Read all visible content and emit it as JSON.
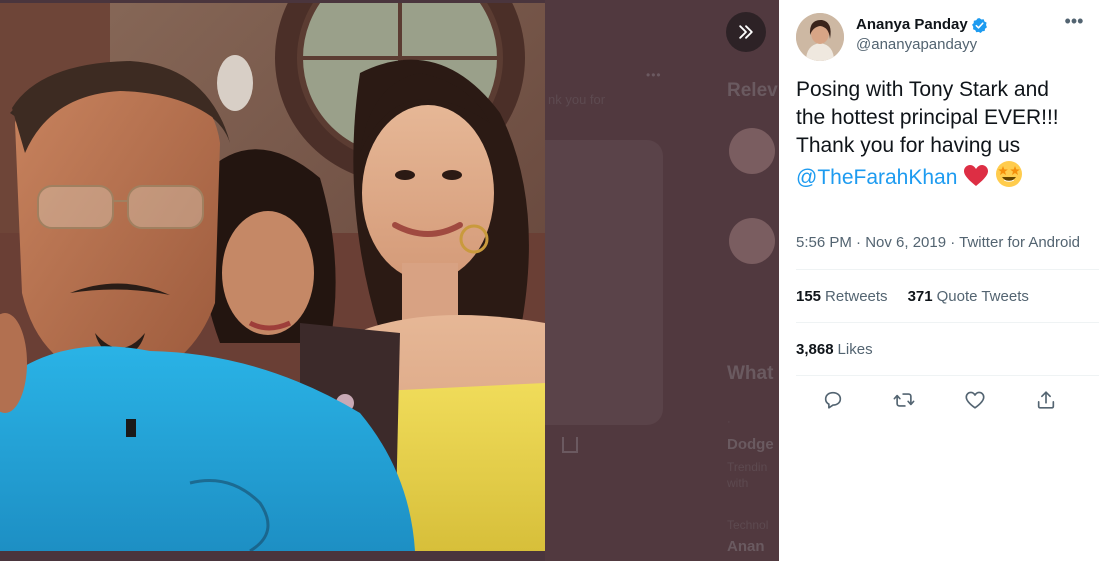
{
  "tweet": {
    "display_name": "Ananya Panday",
    "handle": "@ananyapandayy",
    "text_line1": "Posing with Tony Stark and",
    "text_line2": "the hottest principal EVER!!!",
    "text_line3": "Thank you for having us",
    "mention": "@TheFarahKhan",
    "timestamp": "5:56 PM · Nov 6, 2019 · Twitter for Android",
    "retweets_count": "155",
    "retweets_label": "Retweets",
    "quote_count": "371",
    "quote_label": "Quote Tweets",
    "likes_count": "3,868",
    "likes_label": "Likes"
  },
  "background": {
    "relevant_heading": "Relev",
    "whats_heading": "What",
    "thank_text": "nk you for",
    "trend_title": "Dodge",
    "trend_sub": "Trendin",
    "trend_meta": "with",
    "trend_label": "Technol",
    "trend_title2": "Anan"
  },
  "icons": {
    "expand": "chevrons-right-icon",
    "verified": "verified-badge-icon",
    "more": "more-icon",
    "reply": "reply-icon",
    "retweet": "retweet-icon",
    "like": "heart-icon",
    "share": "share-icon",
    "heart_emoji": "red-heart-emoji",
    "star_eyes_emoji": "star-struck-emoji"
  },
  "colors": {
    "accent": "#1d9bf0",
    "text": "#0f1419",
    "secondary": "#536471"
  }
}
